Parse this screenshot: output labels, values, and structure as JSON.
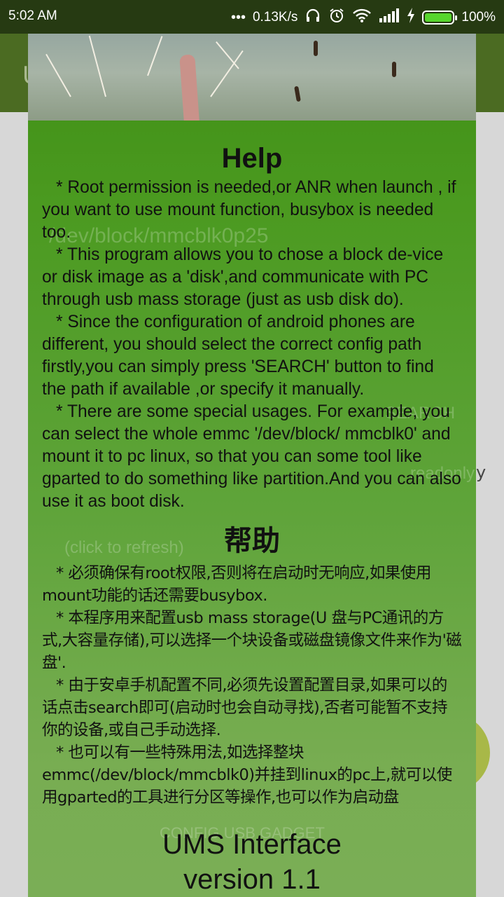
{
  "status_bar": {
    "time": "5:02 AM",
    "network_speed": "0.13K/s",
    "battery_percent": "100%",
    "icons": [
      "more-icon",
      "headphones-icon",
      "alarm-icon",
      "wifi-icon",
      "signal-icon",
      "charging-icon",
      "battery-icon"
    ]
  },
  "app_bar": {
    "title": "U"
  },
  "background_ghosts": {
    "path_value": "/dev/block/mmcblk0p25",
    "search_label": "SEARCH",
    "readonly_label": "readonly",
    "refresh_hint": "(click to refresh)",
    "config_button": "CONFIG USB GADGET"
  },
  "dialog": {
    "title_en": "Help",
    "paragraphs_en": [
      "* Root permission is needed,or ANR when launch , if you want to use mount function, busybox is needed too.",
      "* This program allows you to chose a block de-vice or disk image as a 'disk',and communicate with PC through usb mass storage (just as usb disk do).",
      "* Since the configuration of android phones are different, you should select the correct config path firstly,you can simply press 'SEARCH' button to find the path if available ,or specify it manually.",
      "* There are some special usages. For example, you can select the whole emmc '/dev/block/ mmcblk0' and mount it to pc linux, so that you can some tool like gparted to do something like partition.And you can also use it as boot disk."
    ],
    "title_zh": "帮助",
    "paragraphs_zh": [
      "* 必须确保有root权限,否则将在启动时无响应,如果使用mount功能的话还需要busybox.",
      "* 本程序用来配置usb mass storage(U 盘与PC通讯的方式,大容量存储),可以选择一个块设备或磁盘镜像文件来作为'磁盘'.",
      "* 由于安卓手机配置不同,必须先设置配置目录,如果可以的话点击search即可(启动时也会自动寻找),否者可能暂不支持你的设备,或自己手动选择.",
      "* 也可以有一些特殊用法,如选择整块emmc(/dev/block/mmcblk0)并挂到linux的pc上,就可以使用gparted的工具进行分区等操作,也可以作为启动盘"
    ],
    "footer_line1": "UMS Interface",
    "footer_line2": "version 1.1"
  }
}
